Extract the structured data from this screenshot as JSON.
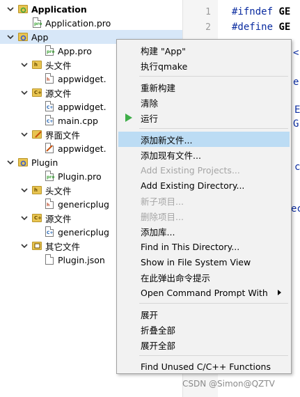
{
  "tree": {
    "rows": [
      {
        "label": "Application",
        "arrow": "down",
        "icon": "project",
        "level": 0,
        "bold": true
      },
      {
        "label": "Application.pro",
        "arrow": "",
        "icon": "pro",
        "level": 1
      },
      {
        "label": "App",
        "arrow": "down",
        "icon": "subproject",
        "level": 0,
        "selected": true
      },
      {
        "label": "App.pro",
        "arrow": "",
        "icon": "pro",
        "level": 2
      },
      {
        "label": "头文件",
        "arrow": "down",
        "icon": "folder-h",
        "level": 1
      },
      {
        "label": "appwidget.",
        "arrow": "",
        "icon": "file-h",
        "level": 2
      },
      {
        "label": "源文件",
        "arrow": "down",
        "icon": "folder-cpp",
        "level": 1
      },
      {
        "label": "appwidget.",
        "arrow": "",
        "icon": "file-cpp",
        "level": 2
      },
      {
        "label": "main.cpp",
        "arrow": "",
        "icon": "file-cpp",
        "level": 2
      },
      {
        "label": "界面文件",
        "arrow": "down",
        "icon": "folder-ui",
        "level": 1
      },
      {
        "label": "appwidget.",
        "arrow": "",
        "icon": "file-ui",
        "level": 2
      },
      {
        "label": "Plugin",
        "arrow": "down",
        "icon": "subproject",
        "level": 0
      },
      {
        "label": "Plugin.pro",
        "arrow": "",
        "icon": "pro",
        "level": 2
      },
      {
        "label": "头文件",
        "arrow": "down",
        "icon": "folder-h",
        "level": 1
      },
      {
        "label": "genericplug",
        "arrow": "",
        "icon": "file-h",
        "level": 2
      },
      {
        "label": "源文件",
        "arrow": "down",
        "icon": "folder-cpp",
        "level": 1
      },
      {
        "label": "genericplug",
        "arrow": "",
        "icon": "file-cpp",
        "level": 2
      },
      {
        "label": "其它文件",
        "arrow": "down",
        "icon": "folder-other",
        "level": 1
      },
      {
        "label": "Plugin.json",
        "arrow": "",
        "icon": "file-plain",
        "level": 2
      }
    ]
  },
  "editor": {
    "line_numbers": [
      "1",
      "2"
    ],
    "lines": [
      {
        "kw": "#ifndef",
        "id": "GE"
      },
      {
        "kw": "#define",
        "id": "GE"
      }
    ],
    "fragments": [
      "<",
      "e",
      "E",
      "G",
      "c",
      "ec"
    ]
  },
  "menu": {
    "items": [
      {
        "label": "构建 \"App\""
      },
      {
        "label": "执行qmake"
      },
      {
        "sep": true
      },
      {
        "label": "重新构建"
      },
      {
        "label": "清除"
      },
      {
        "label": "运行",
        "icon": "play"
      },
      {
        "sep": true
      },
      {
        "label": "添加新文件...",
        "highlighted": true
      },
      {
        "label": "添加现有文件..."
      },
      {
        "label": "Add Existing Projects...",
        "disabled": true
      },
      {
        "label": "Add Existing Directory..."
      },
      {
        "label": "新子项目...",
        "disabled": true
      },
      {
        "label": "删除项目...",
        "disabled": true
      },
      {
        "label": "添加库..."
      },
      {
        "label": "Find in This Directory..."
      },
      {
        "label": "Show in File System View"
      },
      {
        "label": "在此弹出命令提示"
      },
      {
        "label": "Open Command Prompt With",
        "submenu": true
      },
      {
        "sep": true
      },
      {
        "label": "展开"
      },
      {
        "label": "折叠全部"
      },
      {
        "label": "展开全部"
      },
      {
        "sep": true
      },
      {
        "label": "Find Unused C/C++ Functions"
      }
    ]
  },
  "watermark": "CSDN @Simon@QZTV",
  "colors": {
    "highlight": "#bcdcf4",
    "selected_row": "#d7e7f8",
    "run_icon": "#3fae49",
    "keyword": "#0b2ca0"
  }
}
